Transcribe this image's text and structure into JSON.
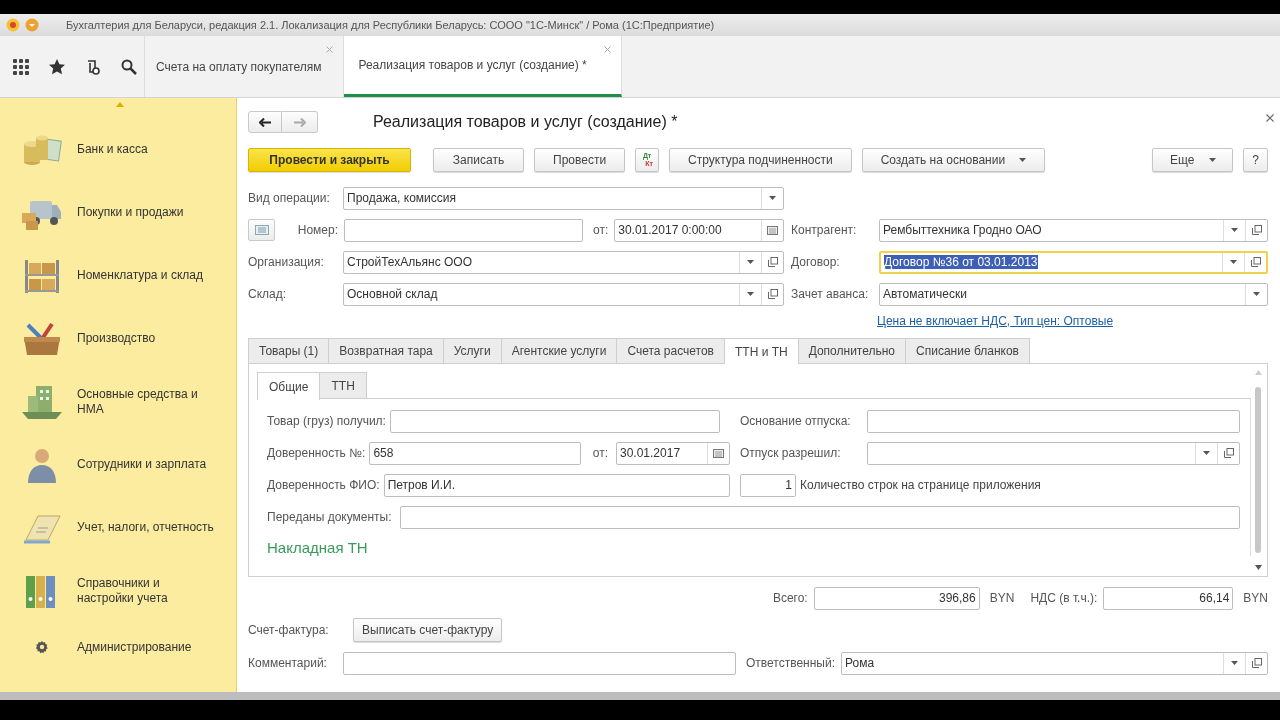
{
  "window": {
    "title": "Бухгалтерия для Беларуси, редакция 2.1. Локализация для Республики Беларусь: СООО \"1С-Минск\" / Рома  (1С:Предприятие)"
  },
  "open_tabs": [
    {
      "label": "Счета на оплату покупателям",
      "selected": false
    },
    {
      "label": "Реализация товаров и услуг (создание) *",
      "selected": true
    }
  ],
  "sidebar": {
    "items": [
      {
        "label": "Банк и касса"
      },
      {
        "label": "Покупки и продажи"
      },
      {
        "label": "Номенклатура и склад"
      },
      {
        "label": "Производство"
      },
      {
        "label": "Основные средства и НМА"
      },
      {
        "label": "Сотрудники и зарплата"
      },
      {
        "label": "Учет, налоги, отчетность"
      },
      {
        "label": "Справочники и настройки учета"
      },
      {
        "label": "Администрирование"
      }
    ]
  },
  "form": {
    "title": "Реализация товаров и услуг (создание) *",
    "commands": [
      {
        "label": "Провести и закрыть",
        "kind": "primary"
      },
      {
        "label": "Записать",
        "kind": "plain"
      },
      {
        "label": "Провести",
        "kind": "plain"
      },
      {
        "label": "Дт",
        "sublabel": "Кт",
        "kind": "dtkt"
      },
      {
        "label": "Структура подчиненности",
        "kind": "plain"
      },
      {
        "label": "Создать на основании",
        "kind": "menu"
      }
    ],
    "more_button": "Еще",
    "help_button": "?",
    "operation": {
      "label": "Вид операции:",
      "value": "Продажа, комиссия",
      "kind": "choice",
      "focused": false
    },
    "number": {
      "label": "Номер:",
      "focused": false
    },
    "date": {
      "label": "от:",
      "value": "30.01.2017  0:00:00",
      "kind": "date",
      "focused": false
    },
    "organization": {
      "label": "Организация:",
      "value": "СтройТехАльянс ООО",
      "kind": "ref",
      "focused": false
    },
    "warehouse": {
      "label": "Склад:",
      "value": "Основной склад",
      "kind": "ref",
      "focused": false
    },
    "right_fields": [
      {
        "label": "Контрагент:",
        "value": "Рембыттехника Гродно ОАО",
        "kind": "ref",
        "focused": false
      },
      {
        "label": "Договор:",
        "value": "Договор №36 от 03.01.2013",
        "kind": "ref",
        "focused": true
      },
      {
        "label": "Зачет аванса:",
        "value": "Автоматически",
        "kind": "choice",
        "focused": false
      }
    ],
    "price_link": "Цена не включает НДС, Тип цен: Оптовые",
    "tabs": [
      {
        "label": "Товары (1)",
        "selected": false
      },
      {
        "label": "Возвратная тара",
        "selected": false
      },
      {
        "label": "Услуги",
        "selected": false
      },
      {
        "label": "Агентские услуги",
        "selected": false
      },
      {
        "label": "Счета расчетов",
        "selected": false
      },
      {
        "label": "ТТН и ТН",
        "selected": true
      },
      {
        "label": "Дополнительно",
        "selected": false
      },
      {
        "label": "Списание бланков",
        "selected": false
      }
    ],
    "subtabs": [
      {
        "label": "Общие",
        "selected": true
      },
      {
        "label": "ТТН",
        "selected": false
      }
    ],
    "received": {
      "label": "Товар (груз) получил:"
    },
    "release_basis": {
      "label": "Основание отпуска:"
    },
    "proxy_number": {
      "label": "Доверенность №:",
      "value": "658"
    },
    "proxy_date": {
      "label": "от:",
      "value": "30.01.2017",
      "kind": "date"
    },
    "release_allowed": {
      "label": "Отпуск разрешил:",
      "kind": "ref"
    },
    "proxy_name": {
      "label": "Доверенность ФИО:",
      "value": "Петров И.И."
    },
    "rows_per_page": {
      "value": "1",
      "label": "Количество строк на странице приложения",
      "kind": "number"
    },
    "documents": {
      "label": "Переданы документы:"
    },
    "section_title": "Накладная ТН",
    "total": {
      "label": "Всего:",
      "value": "396,86",
      "currency": "BYN",
      "kind": "number"
    },
    "vat": {
      "label": "НДС (в т.ч.):",
      "value": "66,14",
      "currency": "BYN",
      "kind": "number"
    },
    "invoice": {
      "label": "Счет-фактура:",
      "button": "Выписать счет-фактуру"
    },
    "comment": {
      "label": "Комментарий:",
      "focused": false
    },
    "responsible": {
      "label": "Ответственный:",
      "value": "Рома",
      "kind": "ref",
      "focused": false
    }
  }
}
